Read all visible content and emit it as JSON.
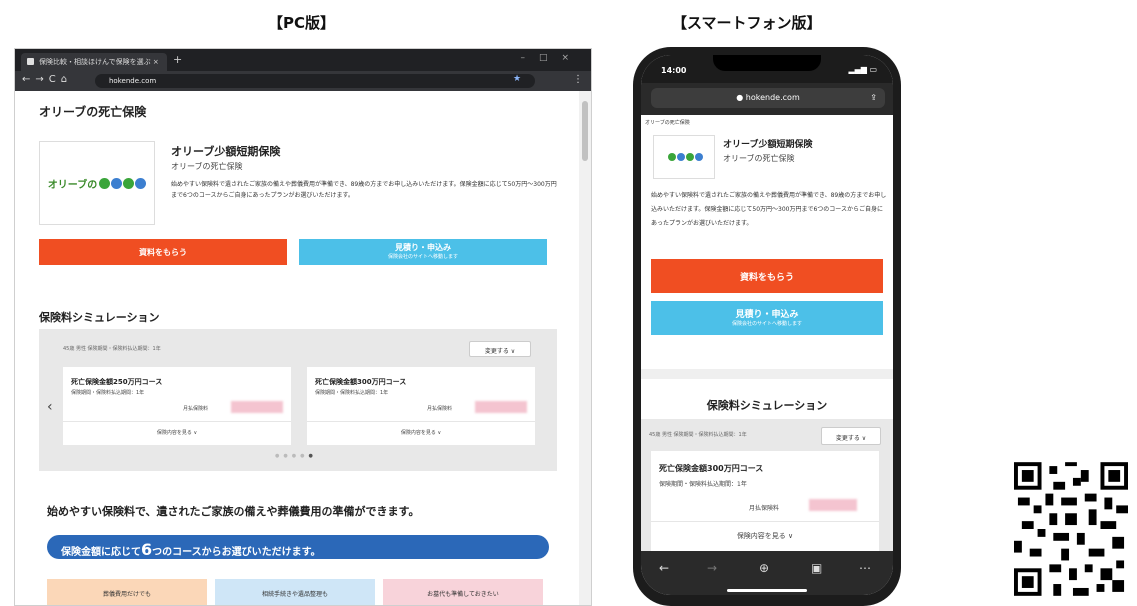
{
  "labels": {
    "pc": "【PC版】",
    "smartphone": "【スマートフォン版】"
  },
  "pc": {
    "tab_title": "保険比較・相談ほけんで保険を選ぶ ×",
    "url": "hokende.com",
    "section_heading": "オリーブの死亡保険",
    "logo_text": "オリーブの",
    "product": {
      "name": "オリーブ少額短期保険",
      "category": "オリーブの死亡保険",
      "description": "始めやすい保険料で遺されたご家族の備えや葬儀費用が準備でき、89歳の方までお申し込みいただけます。保険金額に応じて50万円〜300万円まで6つのコースからご自身にあったプランがお選びいただけます。"
    },
    "buttons": {
      "request_docs": "資料をもらう",
      "quote": "見積り・申込み",
      "quote_sub": "保険会社のサイトへ移動します"
    },
    "simulation": {
      "heading": "保険料シミュレーション",
      "conditions": "45歳 男性 保険期間・保険料払込期間：1年",
      "change_label": "変更する ∨",
      "cards": [
        {
          "name": "死亡保険金額250万円コース",
          "period": "保険期間・保険料払込期間：1年",
          "monthly_label": "月払保険料",
          "detail_label": "保険内容を見る ∨"
        },
        {
          "name": "死亡保険金額300万円コース",
          "period": "保険期間・保険料払込期間：1年",
          "monthly_label": "月払保険料",
          "detail_label": "保険内容を見る ∨"
        }
      ]
    },
    "catch_copy": "始めやすい保険料で、遺されたご家族の備えや葬儀費用の準備ができます。",
    "pill": {
      "prefix": "保険金額に応じて",
      "number": "6",
      "suffix": "つのコースからお選びいただけます。"
    },
    "features": [
      "葬儀費用だけでも",
      "相続手続きや遺品整理も",
      "お墓代も準備しておきたい"
    ]
  },
  "sp": {
    "time": "14:00",
    "url": "hokende.com",
    "breadcrumb": "オリーブの死亡保険",
    "product": {
      "name": "オリーブ少額短期保険",
      "category": "オリーブの死亡保険",
      "description": "始めやすい保険料で遺されたご家族の備えや葬儀費用が準備でき、89歳の方までお申し込みいただけます。保険金額に応じて50万円〜300万円まで6つのコースからご自身にあったプランがお選びいただけます。"
    },
    "buttons": {
      "request_docs": "資料をもらう",
      "quote": "見積り・申込み",
      "quote_sub": "保険会社のサイトへ移動します"
    },
    "simulation": {
      "heading": "保険料シミュレーション",
      "conditions": "45歳 男性 保険期間・保険料払込期間：1年",
      "change_label": "変更する ∨",
      "card": {
        "name": "死亡保険金額300万円コース",
        "period": "保険期間・保険料払込期間：1年",
        "monthly_label": "月払保険料",
        "detail_label": "保険内容を見る ∨"
      }
    }
  },
  "colors": {
    "orange": "#f04e22",
    "blue": "#4cc0e8",
    "pill": "#2b68b8",
    "olive_green": "#3a8a2a"
  }
}
